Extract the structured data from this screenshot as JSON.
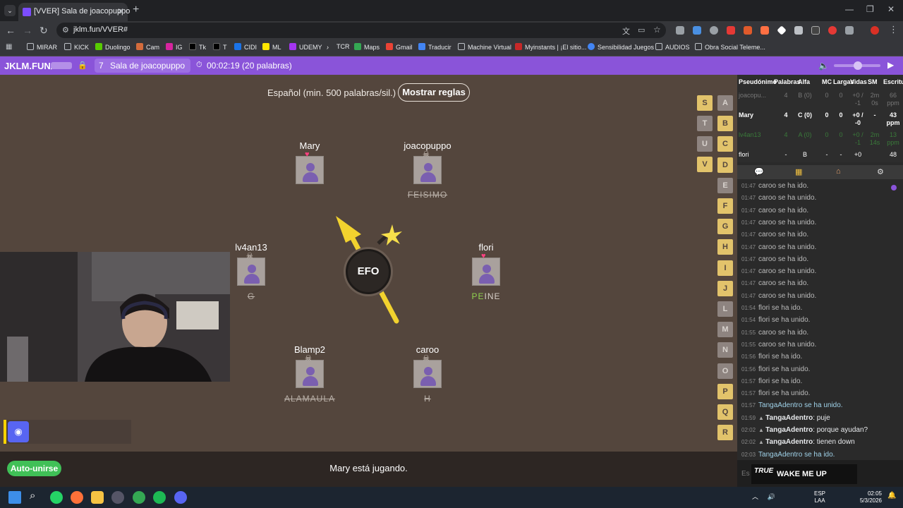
{
  "browser": {
    "tab_title": "[VVER] Sala de joacopuppo",
    "url": "jklm.fun/VVER#",
    "bookmarks": [
      "MIRAR",
      "KICK",
      "Duolingo",
      "Cam",
      "IG",
      "Tk",
      "T",
      "CIDI",
      "ML",
      "UDEMY",
      "TCR",
      "Maps",
      "Gmail",
      "Traducir",
      "Machine Virtual",
      "Myinstants | ¡El sitio...",
      "Sensibilidad Juegos",
      "AUDIOS",
      "Obra Social Teleme..."
    ]
  },
  "header": {
    "site": "JKLM.FUN/",
    "room_number": "7",
    "room_name": "Sala de joacopuppo",
    "timer": "00:02:19 (20 palabras)"
  },
  "game": {
    "rules_text": "Español (min. 500 palabras/sil.)",
    "rules_button": "Mostrar reglas",
    "syllable": "EFO",
    "players": [
      {
        "name": "Mary",
        "status": "heart",
        "word": ""
      },
      {
        "name": "joacopuppo",
        "status": "skull",
        "word": "FEISIMO"
      },
      {
        "name": "lv4an13",
        "status": "skull",
        "word": "G"
      },
      {
        "name": "flori",
        "status": "heart",
        "word_hl": "PE",
        "word_rest": "INE"
      },
      {
        "name": "Blamp2",
        "status": "skull",
        "word": "ALAMAULA"
      },
      {
        "name": "caroo",
        "status": "skull",
        "word": "H"
      }
    ],
    "letters": {
      "col1": [
        "S",
        "T",
        "U",
        "V"
      ],
      "col2": [
        "A",
        "B",
        "C",
        "D",
        "E",
        "F",
        "G",
        "H",
        "I",
        "J",
        "L",
        "M",
        "N",
        "O",
        "P",
        "Q",
        "R"
      ]
    },
    "auto_join": "Auto-unirse",
    "status": "Mary está jugando."
  },
  "scoreboard": {
    "headers": [
      "Pseudónimo",
      "Palabras",
      "Alfa",
      "MC",
      "Largas",
      "Vidas",
      "SM",
      "Escritura"
    ],
    "rows": [
      [
        "joacopu...",
        "4",
        "B (0)",
        "0",
        "0",
        "+0 / -1",
        "2m 0s",
        "66 ppm"
      ],
      [
        "Mary",
        "4",
        "C (0)",
        "0",
        "0",
        "+0 / -0",
        "-",
        "43 ppm"
      ],
      [
        "lv4an13",
        "4",
        "A (0)",
        "0",
        "0",
        "+0 / -1",
        "2m 14s",
        "13 ppm"
      ],
      [
        "flori",
        "-",
        "B",
        "-",
        "-",
        "+0",
        "",
        "48"
      ]
    ]
  },
  "chat": [
    {
      "t": "01:47",
      "msg": "caroo se ha ido."
    },
    {
      "t": "01:47",
      "msg": "caroo se ha unido."
    },
    {
      "t": "01:47",
      "msg": "caroo se ha ido."
    },
    {
      "t": "01:47",
      "msg": "caroo se ha unido."
    },
    {
      "t": "01:47",
      "msg": "caroo se ha ido."
    },
    {
      "t": "01:47",
      "msg": "caroo se ha unido."
    },
    {
      "t": "01:47",
      "msg": "caroo se ha ido."
    },
    {
      "t": "01:47",
      "msg": "caroo se ha unido."
    },
    {
      "t": "01:47",
      "msg": "caroo se ha ido."
    },
    {
      "t": "01:47",
      "msg": "caroo se ha unido."
    },
    {
      "t": "01:54",
      "msg": "flori se ha ido."
    },
    {
      "t": "01:54",
      "msg": "flori se ha unido."
    },
    {
      "t": "01:55",
      "msg": "caroo se ha ido."
    },
    {
      "t": "01:55",
      "msg": "caroo se ha unido."
    },
    {
      "t": "01:56",
      "msg": "flori se ha ido."
    },
    {
      "t": "01:56",
      "msg": "flori se ha unido."
    },
    {
      "t": "01:57",
      "msg": "flori se ha ido."
    },
    {
      "t": "01:57",
      "msg": "flori se ha unido."
    },
    {
      "t": "01:57",
      "msg": "TangaAdentro se ha unido."
    },
    {
      "t": "01:59",
      "user": "TangaAdentro",
      "msg": "puje"
    },
    {
      "t": "02:02",
      "user": "TangaAdentro",
      "msg": "porque ayudan?"
    },
    {
      "t": "02:02",
      "user": "TangaAdentro",
      "msg": "tienen down"
    },
    {
      "t": "02:03",
      "msg": "TangaAdentro se ha ido."
    }
  ],
  "overlay": {
    "song": "WAKE ME UP",
    "brand": "TRUE"
  },
  "taskbar": {
    "lang": "ESP",
    "lang2": "LAA",
    "time": "02:05",
    "date": "5/3/2026"
  },
  "colors": {
    "accent": "#8a54d9",
    "game_bg": "#54463d",
    "letter_on": "#e2c36b",
    "letter_off": "#8e8480",
    "green": "#40c057"
  }
}
